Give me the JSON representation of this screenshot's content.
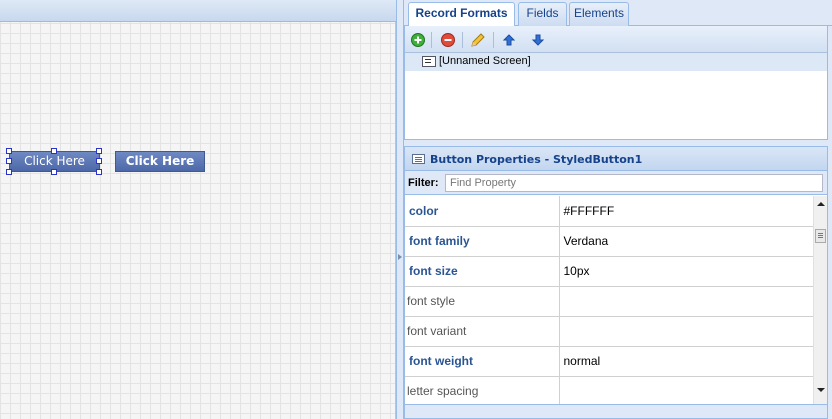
{
  "canvas": {
    "button_selected_label": "Click Here",
    "button_second_label": "Click Here"
  },
  "tabs": [
    {
      "label": "Record Formats",
      "active": true
    },
    {
      "label": "Fields",
      "active": false
    },
    {
      "label": "Elements",
      "active": false
    }
  ],
  "toolbar": {
    "icons": [
      "add-icon",
      "remove-icon",
      "edit-pencil-icon",
      "move-up-icon",
      "move-down-icon"
    ]
  },
  "record_formats": {
    "items": [
      {
        "label": "[Unnamed Screen]"
      }
    ]
  },
  "properties": {
    "title": "Button Properties - StyledButton1",
    "filter_label": "Filter:",
    "filter_placeholder": "Find Property",
    "rows": [
      {
        "name": "color",
        "value": "#FFFFFF",
        "bold": true
      },
      {
        "name": "font family",
        "value": "Verdana",
        "bold": true
      },
      {
        "name": "font size",
        "value": "10px",
        "bold": true
      },
      {
        "name": "font style",
        "value": "",
        "bold": false
      },
      {
        "name": "font variant",
        "value": "",
        "bold": false
      },
      {
        "name": "font weight",
        "value": "normal",
        "bold": true
      },
      {
        "name": "letter spacing",
        "value": "",
        "bold": false
      }
    ]
  },
  "colors": {
    "accent": "#15428b",
    "button_fill": "#5a74b2",
    "selection_handle": "#2a33c9"
  }
}
